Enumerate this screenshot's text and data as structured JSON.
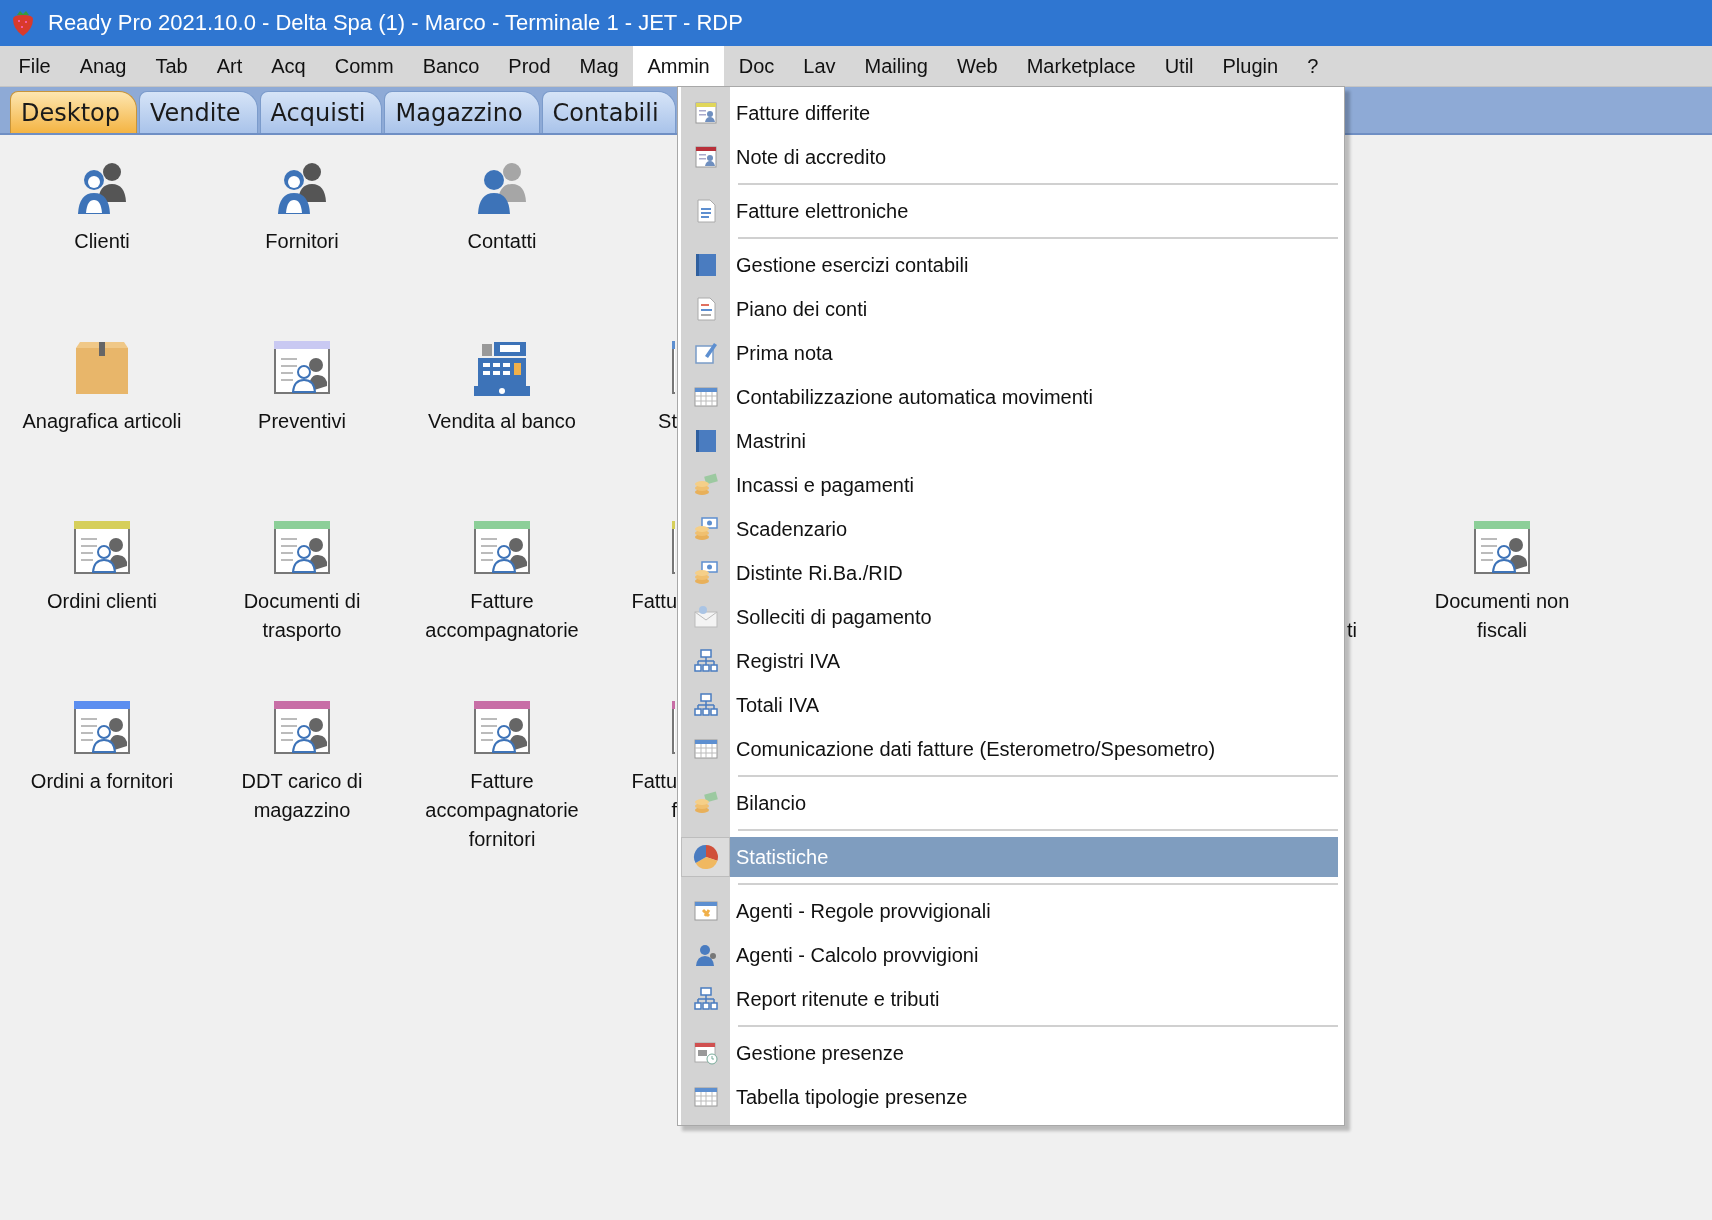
{
  "window": {
    "title": "Ready Pro 2021.10.0 - Delta Spa (1) - Marco - Terminale 1 - JET - RDP"
  },
  "menu_bar": [
    {
      "label": "File",
      "selected": false
    },
    {
      "label": "Anag",
      "selected": false
    },
    {
      "label": "Tab",
      "selected": false
    },
    {
      "label": "Art",
      "selected": false
    },
    {
      "label": "Acq",
      "selected": false
    },
    {
      "label": "Comm",
      "selected": false
    },
    {
      "label": "Banco",
      "selected": false
    },
    {
      "label": "Prod",
      "selected": false
    },
    {
      "label": "Mag",
      "selected": false
    },
    {
      "label": "Ammin",
      "selected": true
    },
    {
      "label": "Doc",
      "selected": false
    },
    {
      "label": "Lav",
      "selected": false
    },
    {
      "label": "Mailing",
      "selected": false
    },
    {
      "label": "Web",
      "selected": false
    },
    {
      "label": "Marketplace",
      "selected": false
    },
    {
      "label": "Util",
      "selected": false
    },
    {
      "label": "Plugin",
      "selected": false
    },
    {
      "label": "?",
      "selected": false
    }
  ],
  "tabs": [
    {
      "label": "Desktop",
      "selected": true
    },
    {
      "label": "Vendite",
      "selected": false
    },
    {
      "label": "Acquisti",
      "selected": false
    },
    {
      "label": "Magazzino",
      "selected": false
    },
    {
      "label": "Contabili",
      "selected": false
    }
  ],
  "desktop": {
    "rows": [
      {
        "items": [
          {
            "kind": "full",
            "label": "Clienti"
          },
          {
            "kind": "full",
            "label": "Fornitori"
          },
          {
            "kind": "full",
            "label": "Contatti"
          }
        ]
      },
      {
        "items": [
          {
            "kind": "full",
            "label": "Anagrafica articoli"
          },
          {
            "kind": "full",
            "label": "Preventivi"
          },
          {
            "kind": "full",
            "label": "Vendita al banco"
          },
          {
            "kind": "cut_right",
            "label": "St"
          }
        ]
      },
      {
        "items": [
          {
            "kind": "full",
            "label": "Ordini clienti"
          },
          {
            "kind": "full",
            "label": "Documenti di trasporto"
          },
          {
            "kind": "full",
            "label": "Fatture accompagnatorie"
          },
          {
            "kind": "cut_right",
            "label": "Fattu"
          },
          {
            "kind": "cut_left",
            "label": "ti"
          },
          {
            "kind": "full",
            "label": "Documenti non fiscali"
          }
        ]
      },
      {
        "items": [
          {
            "kind": "full",
            "label": "Ordini a fornitori"
          },
          {
            "kind": "full",
            "label": "DDT carico di magazzino"
          },
          {
            "kind": "full",
            "label": "Fatture accompagnatorie fornitori"
          },
          {
            "kind": "cut_right",
            "label": "Fattu\nf"
          }
        ]
      }
    ]
  },
  "dropdown_menu": {
    "items": [
      {
        "kind": "item",
        "label": "Fatture differite",
        "selected": false
      },
      {
        "kind": "item",
        "label": "Note di accredito",
        "selected": false
      },
      {
        "kind": "separator"
      },
      {
        "kind": "item",
        "label": "Fatture elettroniche",
        "selected": false
      },
      {
        "kind": "separator"
      },
      {
        "kind": "item",
        "label": "Gestione esercizi contabili",
        "selected": false
      },
      {
        "kind": "item",
        "label": "Piano dei conti",
        "selected": false
      },
      {
        "kind": "item",
        "label": "Prima nota",
        "selected": false
      },
      {
        "kind": "item",
        "label": "Contabilizzazione automatica movimenti",
        "selected": false
      },
      {
        "kind": "item",
        "label": "Mastrini",
        "selected": false
      },
      {
        "kind": "item",
        "label": "Incassi e pagamenti",
        "selected": false
      },
      {
        "kind": "item",
        "label": "Scadenzario",
        "selected": false
      },
      {
        "kind": "item",
        "label": "Distinte Ri.Ba./RID",
        "selected": false
      },
      {
        "kind": "item",
        "label": "Solleciti di pagamento",
        "selected": false
      },
      {
        "kind": "item",
        "label": "Registri IVA",
        "selected": false
      },
      {
        "kind": "item",
        "label": "Totali IVA",
        "selected": false
      },
      {
        "kind": "item",
        "label": "Comunicazione dati fatture (Esterometro/Spesometro)",
        "selected": false
      },
      {
        "kind": "separator"
      },
      {
        "kind": "item",
        "label": "Bilancio",
        "selected": false
      },
      {
        "kind": "separator"
      },
      {
        "kind": "item",
        "label": "Statistiche",
        "selected": true
      },
      {
        "kind": "separator"
      },
      {
        "kind": "item",
        "label": "Agenti - Regole provvigionali",
        "selected": false
      },
      {
        "kind": "item",
        "label": "Agenti - Calcolo provvigioni",
        "selected": false
      },
      {
        "kind": "item",
        "label": "Report ritenute e tributi",
        "selected": false
      },
      {
        "kind": "separator"
      },
      {
        "kind": "item",
        "label": "Gestione presenze",
        "selected": false
      },
      {
        "kind": "item",
        "label": "Tabella tipologie presenze",
        "selected": false
      }
    ]
  }
}
